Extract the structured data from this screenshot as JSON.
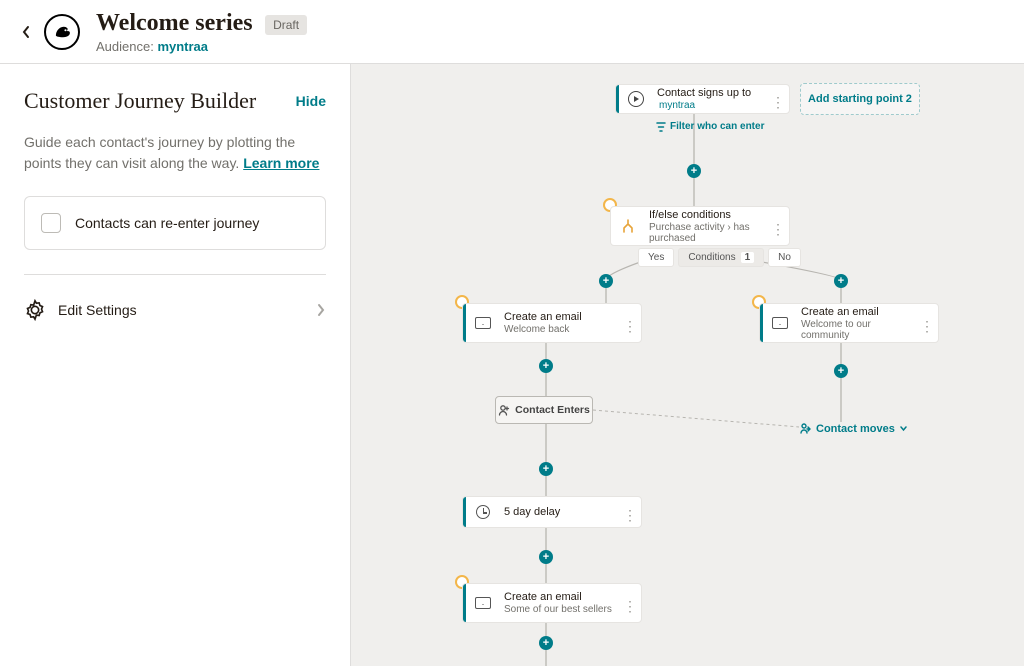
{
  "header": {
    "title": "Welcome series",
    "status": "Draft",
    "audience_label": "Audience: ",
    "audience_link": "myntraa"
  },
  "sidebar": {
    "title": "Customer Journey Builder",
    "hide": "Hide",
    "desc": "Guide each contact's journey by plotting the points they can visit along the way. ",
    "learn_more": "Learn more",
    "reenter_label": "Contacts can re-enter journey",
    "settings": "Edit Settings"
  },
  "canvas": {
    "start": {
      "label": "Contact signs up to",
      "target": "myntraa"
    },
    "add_sp": "Add starting point 2",
    "filter": "Filter who can enter",
    "ifelse": {
      "title": "If/else conditions",
      "sub": "Purchase activity › has purchased"
    },
    "cond": {
      "yes": "Yes",
      "label": "Conditions",
      "count": "1",
      "no": "No"
    },
    "email_a": {
      "title": "Create an email",
      "sub": "Welcome back"
    },
    "email_b": {
      "title": "Create an email",
      "sub": "Welcome to our community"
    },
    "contact_enters": "Contact Enters",
    "contact_moves": "Contact moves",
    "delay": "5 day delay",
    "email_c": {
      "title": "Create an email",
      "sub": "Some of our best sellers"
    }
  }
}
